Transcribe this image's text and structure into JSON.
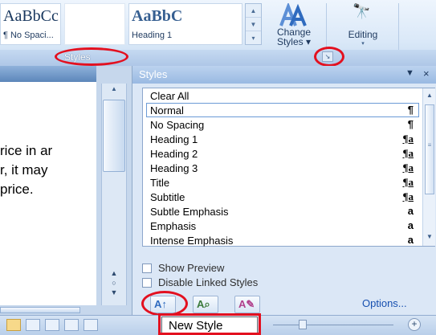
{
  "ribbon": {
    "gallery": [
      {
        "sample": "AaBbCc",
        "name": "¶ No Spaci..."
      },
      {
        "sample": "AaBbC",
        "name": "Heading 1"
      }
    ],
    "change_styles_label": "Change Styles",
    "change_styles_caret": "▾",
    "editing_label": "Editing",
    "editing_caret": "▾",
    "styles_group_label": "Styles",
    "annotation_color": "#e3101f"
  },
  "document": {
    "lines": [
      "rice in ar",
      "r, it may",
      " price."
    ]
  },
  "styles_pane": {
    "title": "Styles",
    "menu_caret": "▼",
    "close": "×",
    "items": [
      {
        "name": "Clear All",
        "mark": ""
      },
      {
        "name": "Normal",
        "mark": "¶",
        "selected": true
      },
      {
        "name": "No Spacing",
        "mark": "¶"
      },
      {
        "name": "Heading 1",
        "mark": "¶a"
      },
      {
        "name": "Heading 2",
        "mark": "¶a"
      },
      {
        "name": "Heading 3",
        "mark": "¶a"
      },
      {
        "name": "Title",
        "mark": "¶a"
      },
      {
        "name": "Subtitle",
        "mark": "¶a"
      },
      {
        "name": "Subtle Emphasis",
        "mark": "a"
      },
      {
        "name": "Emphasis",
        "mark": "a"
      },
      {
        "name": "Intense Emphasis",
        "mark": "a"
      }
    ],
    "show_preview": {
      "label": "Show Preview",
      "checked": false
    },
    "disable_linked": {
      "label": "Disable Linked Styles",
      "checked": false
    },
    "options_link": "Options..."
  },
  "statusbar": {
    "tooltip": "New Style",
    "zoom_in": "+"
  }
}
